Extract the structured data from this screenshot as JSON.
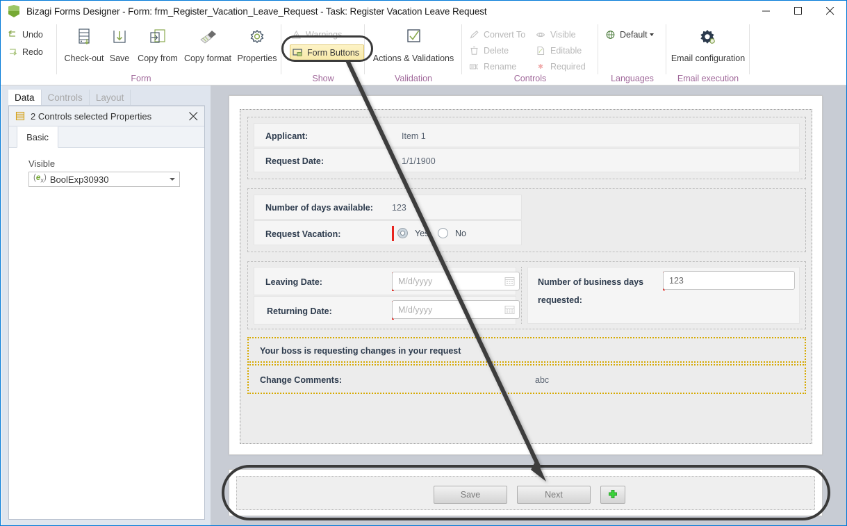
{
  "window": {
    "title": "Bizagi Forms Designer  - Form: frm_Register_Vacation_Leave_Request - Task:  Register Vacation Leave Request",
    "logo_icon": "bizagi-hexagon-logo",
    "controls": [
      {
        "name": "minimize",
        "icon": "minimize-icon"
      },
      {
        "name": "maximize",
        "icon": "maximize-icon"
      },
      {
        "name": "close",
        "icon": "close-icon"
      }
    ]
  },
  "ribbon": {
    "groups": [
      {
        "label": "Form"
      },
      {
        "label": "Show"
      },
      {
        "label": "Validation"
      },
      {
        "label": "Controls"
      },
      {
        "label": "Languages"
      },
      {
        "label": "Email execution"
      }
    ],
    "form_group": {
      "undo": {
        "label": "Undo",
        "icon": "undo-arrow-icon"
      },
      "redo": {
        "label": "Redo",
        "icon": "redo-arrow-icon"
      },
      "checkout": {
        "label": "Check-out",
        "icon": "checkout-icon"
      },
      "save": {
        "label": "Save",
        "icon": "save-download-icon"
      },
      "copy_from": {
        "label": "Copy from",
        "icon": "copy-from-icon"
      },
      "copy_format": {
        "label": "Copy format",
        "icon": "paintbrush-icon"
      },
      "properties": {
        "label": "Properties",
        "icon": "gear-icon"
      }
    },
    "show_group": {
      "warnings": {
        "label": "Warnings",
        "icon": "warning-triangle-icon"
      },
      "form_buttons": {
        "label": "Form Buttons",
        "icon": "form-buttons-icon",
        "selected": true,
        "highlighted": true
      }
    },
    "validation_group": {
      "actions_validations": {
        "label": "Actions & Validations",
        "icon": "checkmark-box-icon"
      }
    },
    "controls_group": {
      "convert_to": {
        "label": "Convert To",
        "icon": "convert-pencil-icon"
      },
      "delete": {
        "label": "Delete",
        "icon": "trash-icon"
      },
      "rename": {
        "label": "Rename",
        "icon": "rename-icon"
      },
      "visible": {
        "label": "Visible",
        "icon": "eye-icon"
      },
      "editable": {
        "label": "Editable",
        "icon": "page-pencil-icon"
      },
      "required": {
        "label": "Required",
        "icon": "asterisk-icon"
      }
    },
    "languages_group": {
      "default": {
        "label": "Default",
        "icon": "globe-icon",
        "has_dropdown": true
      }
    },
    "email_group": {
      "email_configuration": {
        "label": "Email configuration",
        "icon": "gear-hand-icon"
      }
    }
  },
  "left_panel": {
    "tabs": [
      {
        "label": "Data",
        "active": true
      },
      {
        "label": "Controls",
        "active": false
      },
      {
        "label": "Layout",
        "active": false
      }
    ],
    "properties": {
      "header_icon": "controls-stack-icon",
      "header_title": "2 Controls selected Properties",
      "close_icon": "close-icon",
      "inner_tab": "Basic",
      "field_label": "Visible",
      "field_icon": "expression-icon",
      "field_icon_text": "(ex)",
      "field_value": "BoolExp30930",
      "dropdown_icon": "chevron-down-icon"
    }
  },
  "form": {
    "sections": [
      {
        "name": "applicant-section",
        "rows": [
          {
            "label": "Applicant:",
            "value": "Item 1",
            "type": "text"
          },
          {
            "label": "Request Date:",
            "value": "1/1/1900",
            "type": "text"
          }
        ]
      },
      {
        "name": "days-section",
        "rows": [
          {
            "label": "Number of days available:",
            "value": "123",
            "type": "text"
          },
          {
            "label": "Request Vacation:",
            "type": "radio",
            "options": [
              {
                "label": "Yes",
                "selected": true
              },
              {
                "label": "No",
                "selected": false
              }
            ]
          }
        ]
      },
      {
        "name": "dates-section",
        "rows": [
          {
            "label": "Leaving Date:",
            "placeholder": "M/d/yyyy",
            "type": "date",
            "icon": "calendar-icon"
          },
          {
            "label": "Returning Date:",
            "placeholder": "M/d/yyyy",
            "type": "date",
            "icon": "calendar-icon"
          }
        ],
        "right": {
          "label_line1": "Number of business days",
          "label_line2": "requested:",
          "value": "123"
        }
      },
      {
        "name": "boss-message-section",
        "highlighted": true,
        "message": "Your boss is requesting changes in your request"
      },
      {
        "name": "change-comments-section",
        "highlighted": true,
        "rows": [
          {
            "label": "Change Comments:",
            "value": "abc",
            "type": "text"
          }
        ]
      }
    ]
  },
  "button_bar": {
    "highlighted": true,
    "buttons": [
      {
        "label": "Save",
        "name": "save-form-button"
      },
      {
        "label": "Next",
        "name": "next-form-button"
      },
      {
        "label": "",
        "name": "add-button",
        "icon": "plus-icon"
      }
    ]
  },
  "annotation": {
    "arrow": "callout-arrow-from-form-buttons-to-button-bar"
  },
  "colors": {
    "accent": "#0078d7",
    "group_label": "#a0689a",
    "highlight_yellow": "#f8e9a8",
    "highlight_border": "#e0c870",
    "dotted_highlight": "#d6a900",
    "required_red": "#e8251f",
    "brand_green": "#76a935",
    "canvas_gray": "#c8ccd4",
    "panel_blue": "#dfe5ee",
    "label_navy": "#2d3b4d"
  }
}
